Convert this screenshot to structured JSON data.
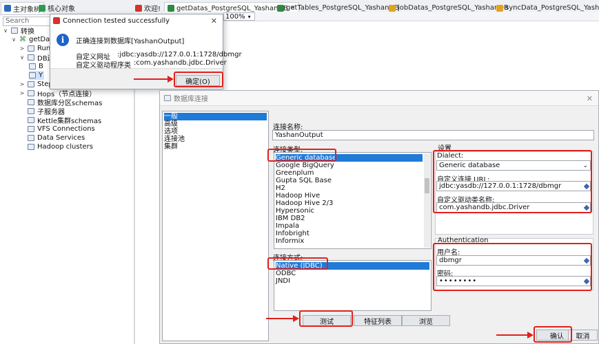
{
  "top_tabs": [
    {
      "label": "主对象树",
      "color": "#2d6ab8"
    },
    {
      "label": "核心对象",
      "color": "#2d9a52"
    }
  ],
  "editor_tabs": [
    {
      "label": "欢迎!",
      "color": "#d4332e"
    },
    {
      "label": "getDatas_PostgreSQL_YashanDB",
      "color": "#2f8a3f"
    },
    {
      "label": "getTables_PostgreSQL_YashanDB",
      "color": "#2f8a3f"
    },
    {
      "label": "jobDatas_PostgreSQL_YashanDB",
      "color": "#e2a31e"
    },
    {
      "label": "syncData_PostgreSQL_YashanDB",
      "color": "#e2a31e"
    }
  ],
  "search": {
    "placeholder": "Search"
  },
  "zoom": "100%",
  "tree": {
    "root": "转换",
    "transform": "getDat",
    "children": [
      "Run",
      "DB连",
      "B",
      "Y"
    ],
    "steps": "Step",
    "hops": "Hops（节点连接）",
    "items": [
      "数据库分区schemas",
      "子服务器",
      "Kettle集群schemas",
      "VFS Connections",
      "Data Services",
      "Hadoop clusters"
    ]
  },
  "test_dialog": {
    "title": "Connection tested successfully",
    "message": "正确连接到数据库[YashanOutput]",
    "url_label": "自定义网址",
    "url_value": ":jdbc:yasdb://127.0.0.1:1728/dbmgr",
    "driver_label": "自定义驱动程序类",
    "driver_value": ":com.yashandb.jdbc.Driver",
    "ok_button": "确定(O)"
  },
  "db_window": {
    "title": "数据库连接",
    "categories": [
      "一般",
      "高级",
      "选项",
      "连接池",
      "集群"
    ],
    "selected_category": 0,
    "conn_name_label": "连接名称:",
    "conn_name_value": "YashanOutput",
    "conn_type_label": "连接类型:",
    "conn_types": [
      "Generic database",
      "Google BigQuery",
      "Greenplum",
      "Gupta SQL Base",
      "H2",
      "Hadoop Hive",
      "Hadoop Hive 2/3",
      "Hypersonic",
      "IBM DB2",
      "Impala",
      "Infobright",
      "Informix"
    ],
    "selected_type": 0,
    "access_label": "连接方式:",
    "access_methods": [
      "Native (JDBC)",
      "ODBC",
      "JNDI"
    ],
    "selected_access": 0,
    "settings_label": "设置",
    "dialect_label": "Dialect:",
    "dialect_value": "Generic database",
    "url_label": "自定义连接 URL:",
    "url_value": "jdbc:yasdb://127.0.0.1:1728/dbmgr",
    "driver_label": "自定义驱动类名称:",
    "driver_value": "com.yashandb.jdbc.Driver",
    "auth_label": "Authentication",
    "username_label": "用户名:",
    "username_value": "dbmgr",
    "password_label": "密码:",
    "password_value": "••••••••",
    "test_button": "测试",
    "features_button": "特征列表",
    "explore_button": "浏览",
    "ok_button": "确认",
    "cancel_button": "取消"
  },
  "colors": {
    "highlight": "#e0201c",
    "selection": "#1f7ad8",
    "info": "#1e63c7"
  }
}
